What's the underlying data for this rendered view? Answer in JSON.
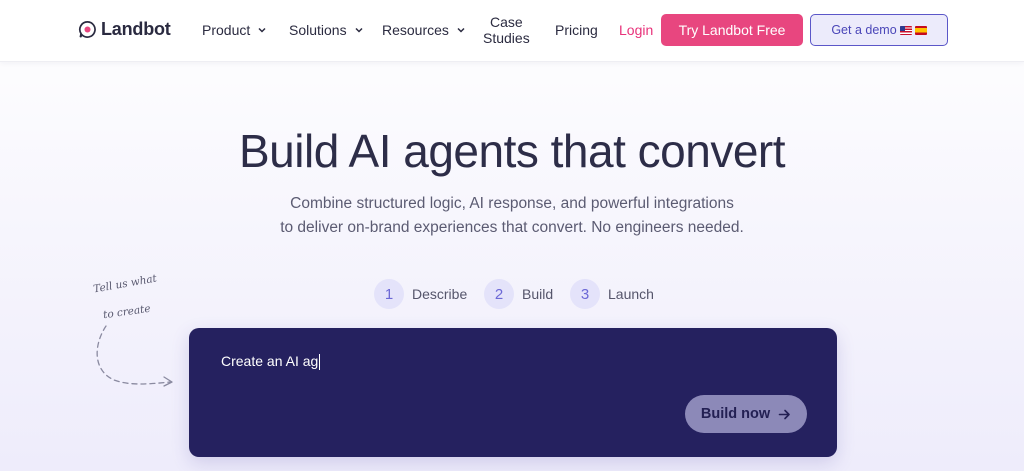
{
  "nav": {
    "logo_text": "Landbot",
    "items": [
      {
        "label": "Product"
      },
      {
        "label": "Solutions"
      },
      {
        "label": "Resources"
      }
    ],
    "case_studies": [
      "Case",
      "Studies"
    ],
    "pricing": "Pricing",
    "login": "Login",
    "try_button": "Try Landbot Free",
    "demo_button": "Get a demo"
  },
  "hero": {
    "title": "Build AI agents that convert",
    "subtitle_lines": [
      "Combine structured logic, AI response, and powerful integrations",
      "to deliver on-brand experiences that convert. No engineers needed."
    ]
  },
  "steps": [
    {
      "number": "1",
      "label": "Describe"
    },
    {
      "number": "2",
      "label": "Build"
    },
    {
      "number": "3",
      "label": "Launch"
    }
  ],
  "note": {
    "line1": "Tell us what",
    "line2": "to create"
  },
  "prompt": {
    "value": "Create an AI ag",
    "build_button": "Build now"
  },
  "colors": {
    "accent_pink": "#e8467f",
    "login_pink": "#e8327a",
    "brand_indigo": "#25215f",
    "step_circle": "#e4e3fa",
    "demo_border": "#5b57c8"
  },
  "icons": {
    "logo": "speech-bubble-logo-icon",
    "dropdown": "chevron-down-icon",
    "flags": [
      "us-flag-icon",
      "spain-flag-icon"
    ],
    "build": "arrow-right-icon"
  }
}
